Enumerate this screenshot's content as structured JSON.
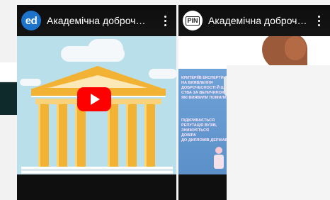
{
  "videos": [
    {
      "title": "Академічна доброч…",
      "channel_logo_text": "ed",
      "channel_logo_icon": "edera-logo",
      "menu_icon": "more-vert-icon",
      "play_icon": "youtube-play-icon"
    },
    {
      "title": "Академічна доброч…",
      "channel_logo_text": "PIN",
      "channel_logo_icon": "pin-logo",
      "menu_icon": "more-vert-icon",
      "slide_lines_1": [
        "КРИТЕРІЇВ ЕКСПЕРТИ ДАЮТЬ",
        "НА ВИЯВЛЕННЯ",
        "ДОБРОЧЕСНОСТІ Й ШАХРАЙ-",
        "СТВА ЗА ВЕЛИЧИНОЮ...",
        "ЯКІ ВИЯВИЛИ ПОМИЛКИ"
      ],
      "slide_lines_2": [
        "ПІДКРИВАЄТЬСЯ",
        "РЕПУТАЦІЯ ВУЗІВ,",
        "ЗНИЖУЄТЬСЯ",
        "ДОВІРА",
        "ДО ДИПЛОМІВ ДЕРЖАВИ"
      ]
    }
  ],
  "colors": {
    "youtube_red": "#ff0000",
    "channel_blue": "#1d72c9",
    "temple_gold": "#f2b233",
    "sky": "#b9dfea",
    "slide_blue": "#6fa2d6"
  }
}
